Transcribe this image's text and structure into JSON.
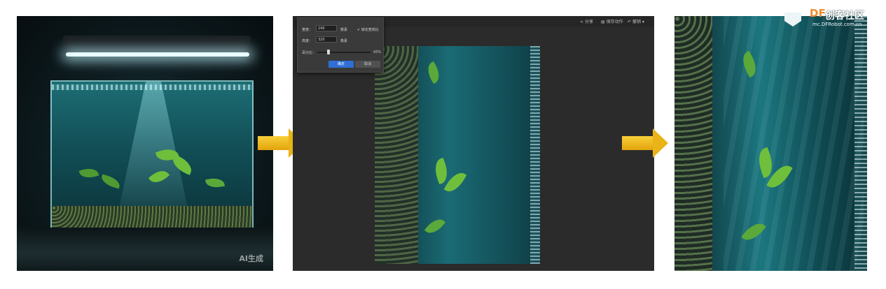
{
  "panel1": {
    "caption": "AI生成"
  },
  "editor": {
    "topbar": {
      "share": "分享",
      "save_action": "保存动作",
      "undo": "撤销"
    },
    "dialog": {
      "width_label": "宽度：",
      "width_value": "240",
      "width_unit": "像素",
      "height_label": "高度：",
      "height_value": "320",
      "height_unit": "像素",
      "lock_ratio": "锁定宽高比",
      "percent_label": "百分比：",
      "percent_value": "43%",
      "confirm": "确定",
      "cancel": "取消"
    }
  },
  "watermark": {
    "brand_df": "DF",
    "brand_cn": "创客社区",
    "url": "mc.DFRobot.com.cn"
  },
  "colors": {
    "arrow": "#eab418",
    "confirm_button": "#2f6fd6",
    "logo_orange": "#f08a2e"
  }
}
